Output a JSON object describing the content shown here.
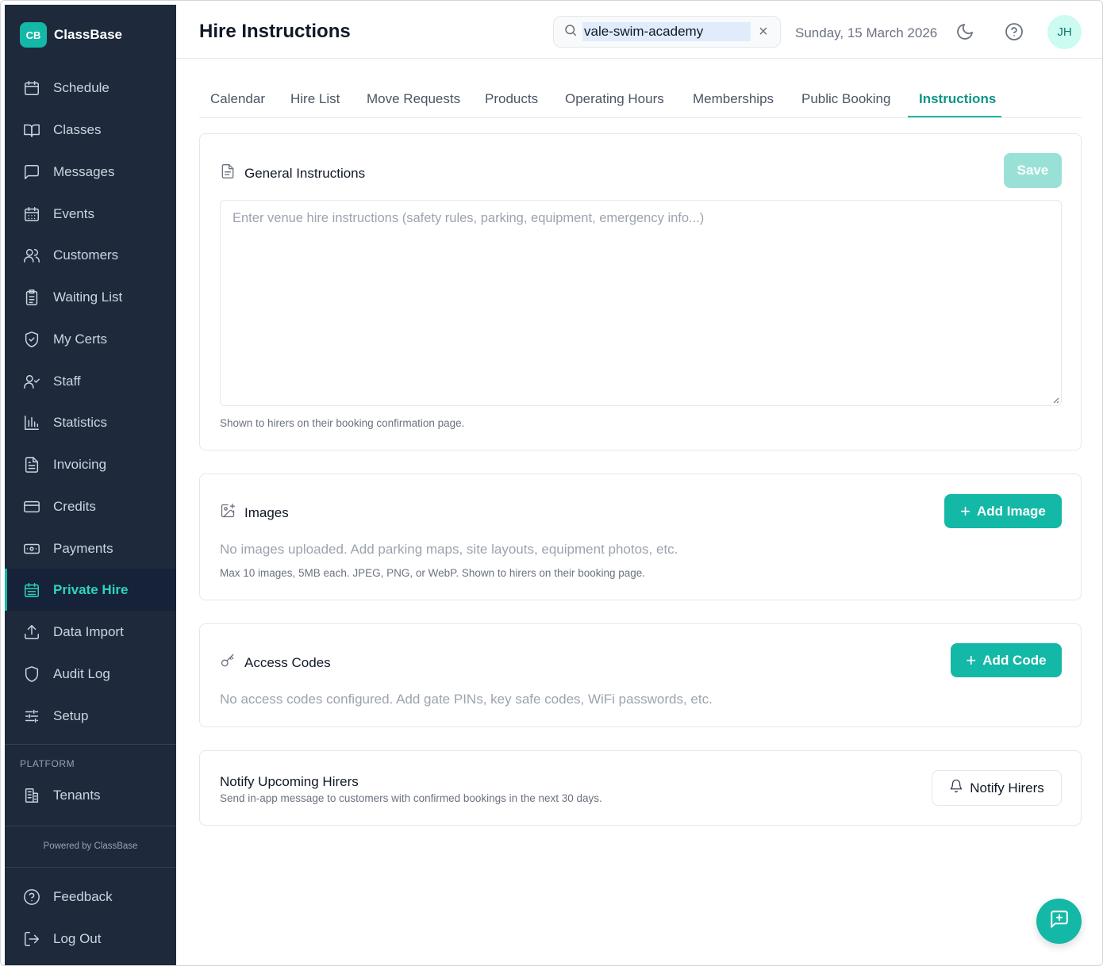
{
  "brand": {
    "logo_text": "CB",
    "name": "ClassBase"
  },
  "sidebar": {
    "items": [
      {
        "label": "Schedule",
        "icon": "calendar-icon"
      },
      {
        "label": "Classes",
        "icon": "book-open-icon"
      },
      {
        "label": "Messages",
        "icon": "message-square-icon"
      },
      {
        "label": "Events",
        "icon": "calendar-days-icon"
      },
      {
        "label": "Customers",
        "icon": "users-icon"
      },
      {
        "label": "Waiting List",
        "icon": "clipboard-list-icon"
      },
      {
        "label": "My Certs",
        "icon": "shield-check-icon"
      },
      {
        "label": "Staff",
        "icon": "user-check-icon"
      },
      {
        "label": "Statistics",
        "icon": "bar-chart-icon"
      },
      {
        "label": "Invoicing",
        "icon": "file-text-icon"
      },
      {
        "label": "Credits",
        "icon": "credit-card-icon"
      },
      {
        "label": "Payments",
        "icon": "banknote-icon"
      },
      {
        "label": "Private Hire",
        "icon": "calendar-grid-icon",
        "active": true
      },
      {
        "label": "Data Import",
        "icon": "upload-icon"
      },
      {
        "label": "Audit Log",
        "icon": "shield-icon"
      },
      {
        "label": "Setup",
        "icon": "sliders-icon"
      }
    ],
    "platform_label": "PLATFORM",
    "platform_items": [
      {
        "label": "Tenants",
        "icon": "building-icon"
      }
    ],
    "powered_by": "Powered by ClassBase",
    "footer_items": [
      {
        "label": "Feedback",
        "icon": "help-circle-icon"
      },
      {
        "label": "Log Out",
        "icon": "log-out-icon"
      }
    ]
  },
  "header": {
    "title": "Hire Instructions",
    "search_value": "vale-swim-academy",
    "date": "Sunday, 15 March 2026",
    "avatar_initials": "JH"
  },
  "tabs": [
    {
      "label": "Calendar"
    },
    {
      "label": "Hire List"
    },
    {
      "label": "Move Requests"
    },
    {
      "label": "Products"
    },
    {
      "label": "Operating Hours"
    },
    {
      "label": "Memberships"
    },
    {
      "label": "Public Booking"
    },
    {
      "label": "Instructions",
      "active": true
    }
  ],
  "general": {
    "title": "General Instructions",
    "save_label": "Save",
    "placeholder": "Enter venue hire instructions (safety rules, parking, equipment, emergency info...)",
    "value": "",
    "hint": "Shown to hirers on their booking confirmation page."
  },
  "images": {
    "title": "Images",
    "add_label": "Add Image",
    "empty": "No images uploaded. Add parking maps, site layouts, equipment photos, etc.",
    "hint": "Max 10 images, 5MB each. JPEG, PNG, or WebP. Shown to hirers on their booking page."
  },
  "access": {
    "title": "Access Codes",
    "add_label": "Add Code",
    "empty": "No access codes configured. Add gate PINs, key safe codes, WiFi passwords, etc."
  },
  "notify": {
    "title": "Notify Upcoming Hirers",
    "subtitle": "Send in-app message to customers with confirmed bookings in the next 30 days.",
    "button_label": "Notify Hirers"
  },
  "colors": {
    "accent": "#14b8a6",
    "sidebar_bg": "#1e293b",
    "active_text": "#2dd4bf"
  }
}
